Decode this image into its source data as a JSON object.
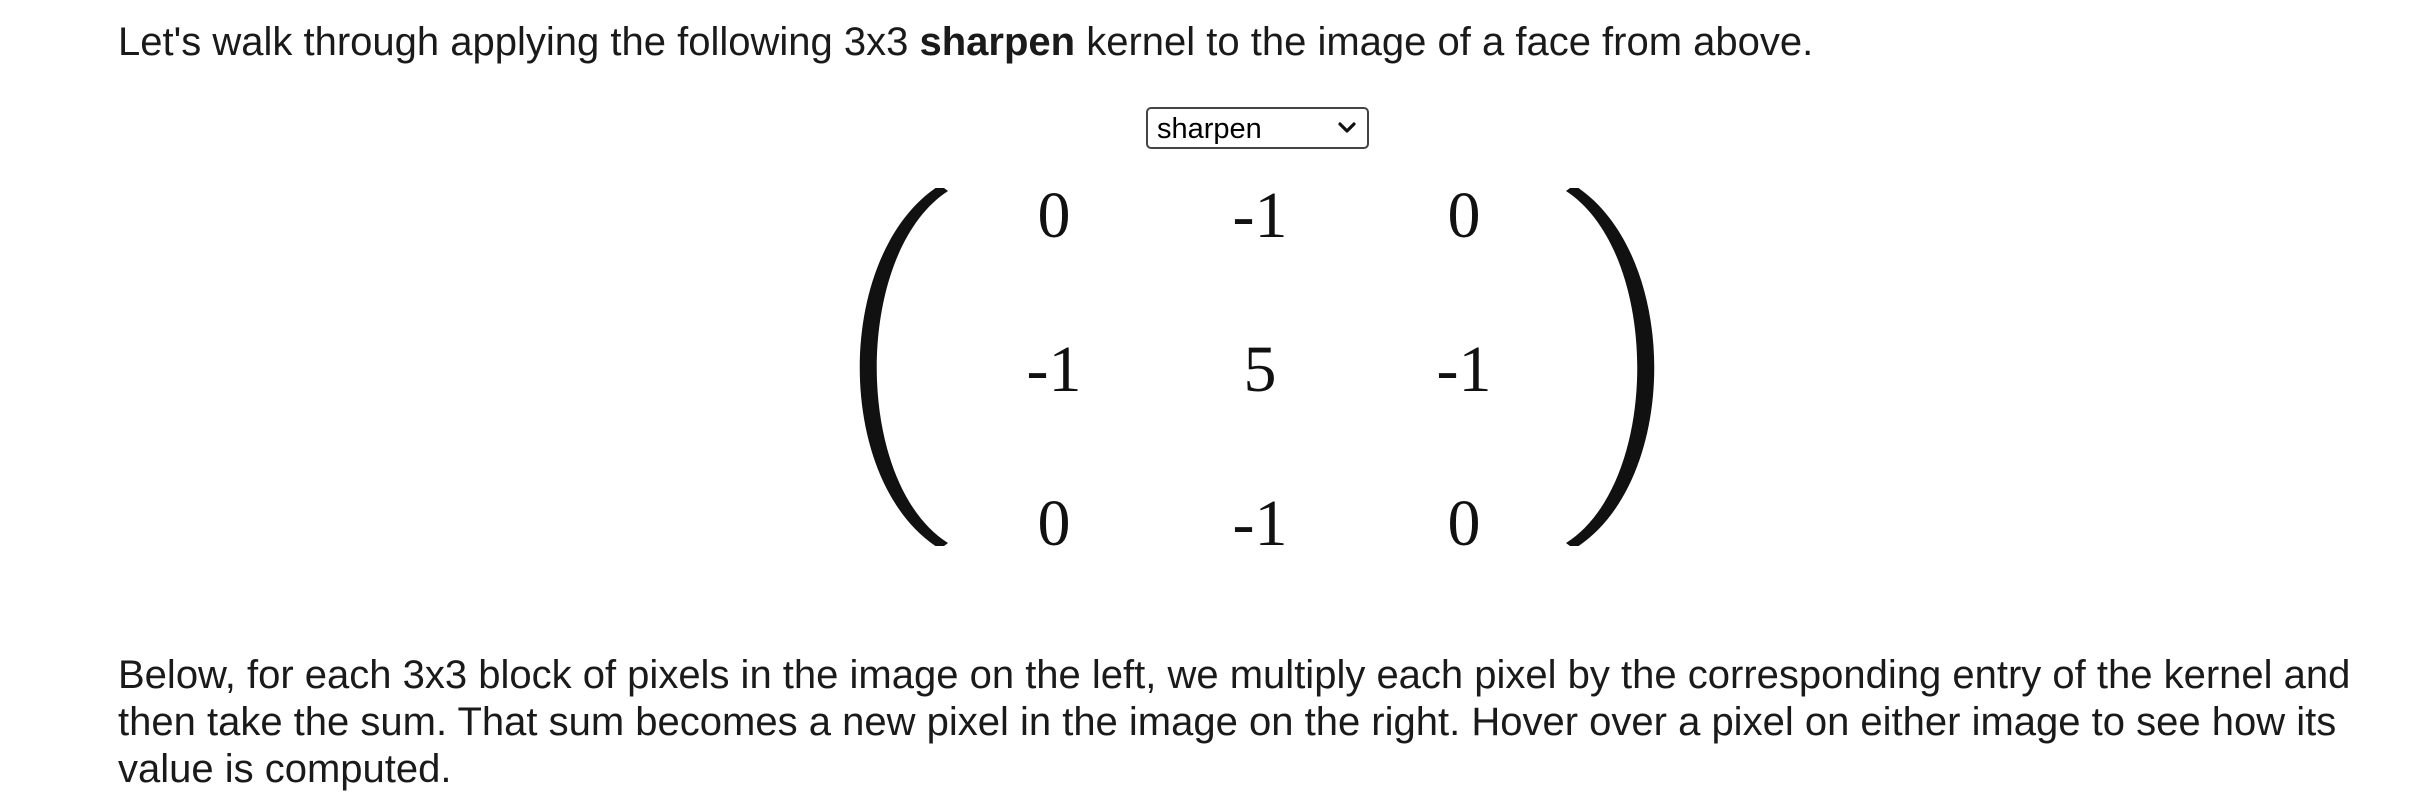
{
  "intro": {
    "before": "Let's walk through applying the following 3x3 ",
    "kernel_name": "sharpen",
    "after": " kernel to the image of a face from above."
  },
  "kernel_select": {
    "value": "sharpen",
    "icon": "chevron-down-icon"
  },
  "kernel": {
    "rows": [
      [
        "0",
        "-1",
        "0"
      ],
      [
        "-1",
        "5",
        "-1"
      ],
      [
        "0",
        "-1",
        "0"
      ]
    ]
  },
  "explanation": "Below, for each 3x3 block of pixels in the image on the left, we multiply each pixel by the corresponding entry of the kernel and then take the sum. That sum becomes a new pixel in the image on the right. Hover over a pixel on either image to see how its value is computed."
}
